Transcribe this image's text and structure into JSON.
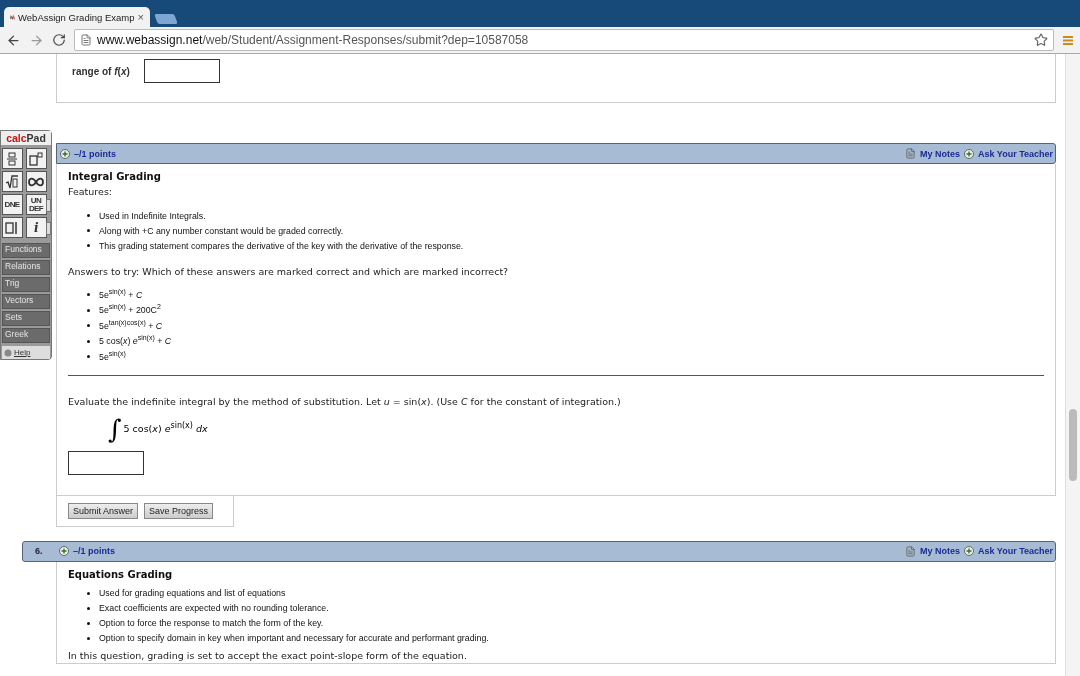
{
  "browser": {
    "tab_title": "WebAssign Grading Examp",
    "close_glyph": "×",
    "url_host": "www.webassign.net",
    "url_path": "/web/Student/Assignment-Responses/submit?dep=10587058"
  },
  "previous_question": {
    "label": "range of *f*(*x*)"
  },
  "calcpad": {
    "title_a": "calc",
    "title_b": "Pad",
    "keys": [
      {
        "kind": "fraction"
      },
      {
        "kind": "power"
      },
      {
        "kind": "root"
      },
      {
        "kind": "infinity"
      },
      {
        "kind": "text",
        "label": "DNE"
      },
      {
        "kind": "text",
        "label": "UN DEF",
        "more": true
      },
      {
        "kind": "abs"
      },
      {
        "kind": "info",
        "label": "i",
        "more": true
      }
    ],
    "menus": [
      "Functions",
      "Relations",
      "Trig",
      "Vectors",
      "Sets",
      "Greek"
    ],
    "help": "Help"
  },
  "questions": [
    {
      "points": "–/1 points",
      "my_notes": "My Notes",
      "ask_teacher": "Ask Your Teacher",
      "title": "Integral Grading",
      "intro": "Features:",
      "features": [
        "Used in Indefinite Integrals.",
        "Along with +C any number constant would be graded correctly.",
        "This grading statement compares the derivative of the key with the derivative of the response."
      ],
      "prompt": "Answers to try: Which of these answers are marked correct and which are marked incorrect?",
      "answers": [
        "5e$^{sin(x)}$ + *C*",
        "5e$^{sin(x)}$ + 200C$^{2}$",
        "5e$^{tan(x)cos(x)}$ + *C*",
        "5 cos(*x*) *e*$^{sin(x)}$ + *C*",
        "5e$^{sin(x)}$"
      ],
      "question": "Evaluate the indefinite integral by the method of substitution. Let  *u* = sin(*x*).  (Use *C* for the constant of integration.)",
      "integral_sign": "∫",
      "integrand": "5 cos(*x*) *e*$^{sin(x)}$ *dx*",
      "buttons": [
        "Submit Answer",
        "Save Progress"
      ]
    },
    {
      "number": "6.",
      "points": "–/1 points",
      "my_notes": "My Notes",
      "ask_teacher": "Ask Your Teacher",
      "title": "Equations Grading",
      "features": [
        "Used for grading equations and list of equations",
        "Exact coefficients are expected with no rounding tolerance.",
        "Option to force the response to match the form of the key.",
        "Option to specify domain in key when important and necessary for accurate and performant grading."
      ],
      "prompt": "In this question, grading is set to accept the exact point-slope form of the equation."
    }
  ]
}
